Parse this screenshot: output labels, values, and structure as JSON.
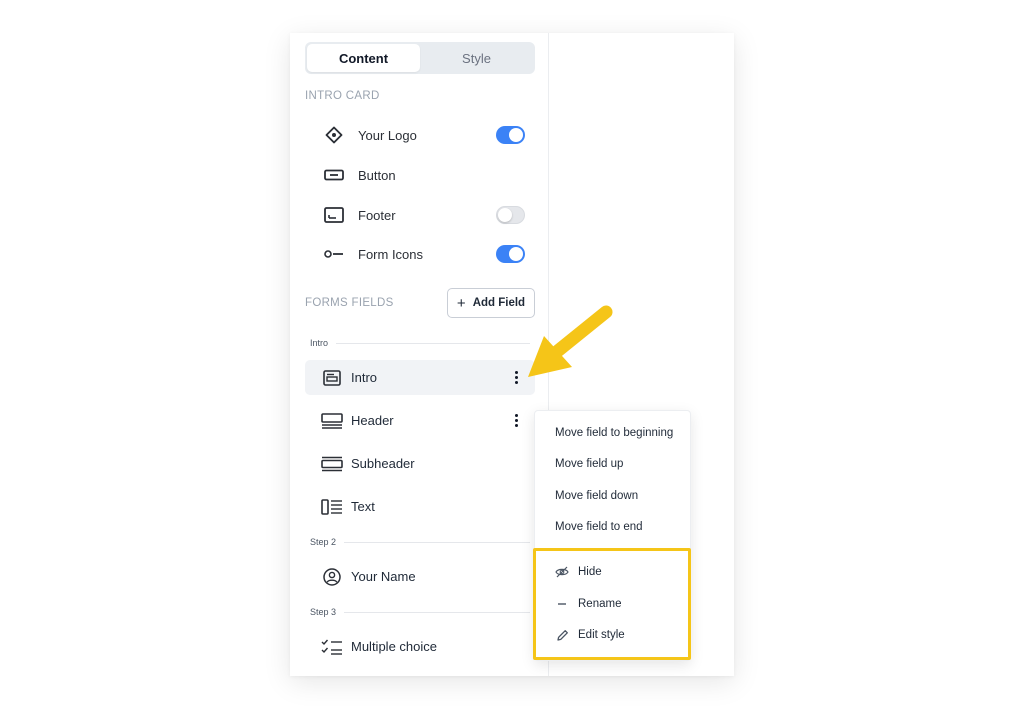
{
  "tabs": [
    {
      "label": "Content",
      "active": true
    },
    {
      "label": "Style",
      "active": false
    }
  ],
  "intro_card": {
    "title": "INTRO CARD",
    "items": [
      {
        "label": "Your Logo",
        "icon": "diamond-icon",
        "toggle": "on"
      },
      {
        "label": "Button",
        "icon": "button-icon",
        "toggle": null
      },
      {
        "label": "Footer",
        "icon": "footer-icon",
        "toggle": "off"
      },
      {
        "label": "Form Icons",
        "icon": "form-icons-icon",
        "toggle": "on"
      }
    ]
  },
  "form_fields": {
    "title": "FORMS FIELDS",
    "add_button": "Add Field",
    "groups": [
      {
        "label": "Intro"
      },
      {
        "label": "Step 2"
      },
      {
        "label": "Step 3"
      }
    ],
    "fields": [
      {
        "label": "Intro",
        "icon": "intro-icon",
        "selected": true
      },
      {
        "label": "Header",
        "icon": "header-icon",
        "selected": false
      },
      {
        "label": "Subheader",
        "icon": "subheader-icon",
        "selected": false
      },
      {
        "label": "Text",
        "icon": "text-icon",
        "selected": false
      },
      {
        "label": "Your Name",
        "icon": "user-icon",
        "selected": false
      },
      {
        "label": "Multiple choice",
        "icon": "checklist-icon",
        "selected": false
      }
    ]
  },
  "context_menu": {
    "items": [
      "Move field to beginning",
      "Move field up",
      "Move field down",
      "Move field to end"
    ],
    "actions": [
      {
        "label": "Hide",
        "icon": "eye-off-icon"
      },
      {
        "label": "Rename",
        "icon": "dash-icon"
      },
      {
        "label": "Edit style",
        "icon": "pencil-icon"
      }
    ]
  },
  "colors": {
    "accent": "#3b82f6",
    "highlight": "#f5c518"
  }
}
